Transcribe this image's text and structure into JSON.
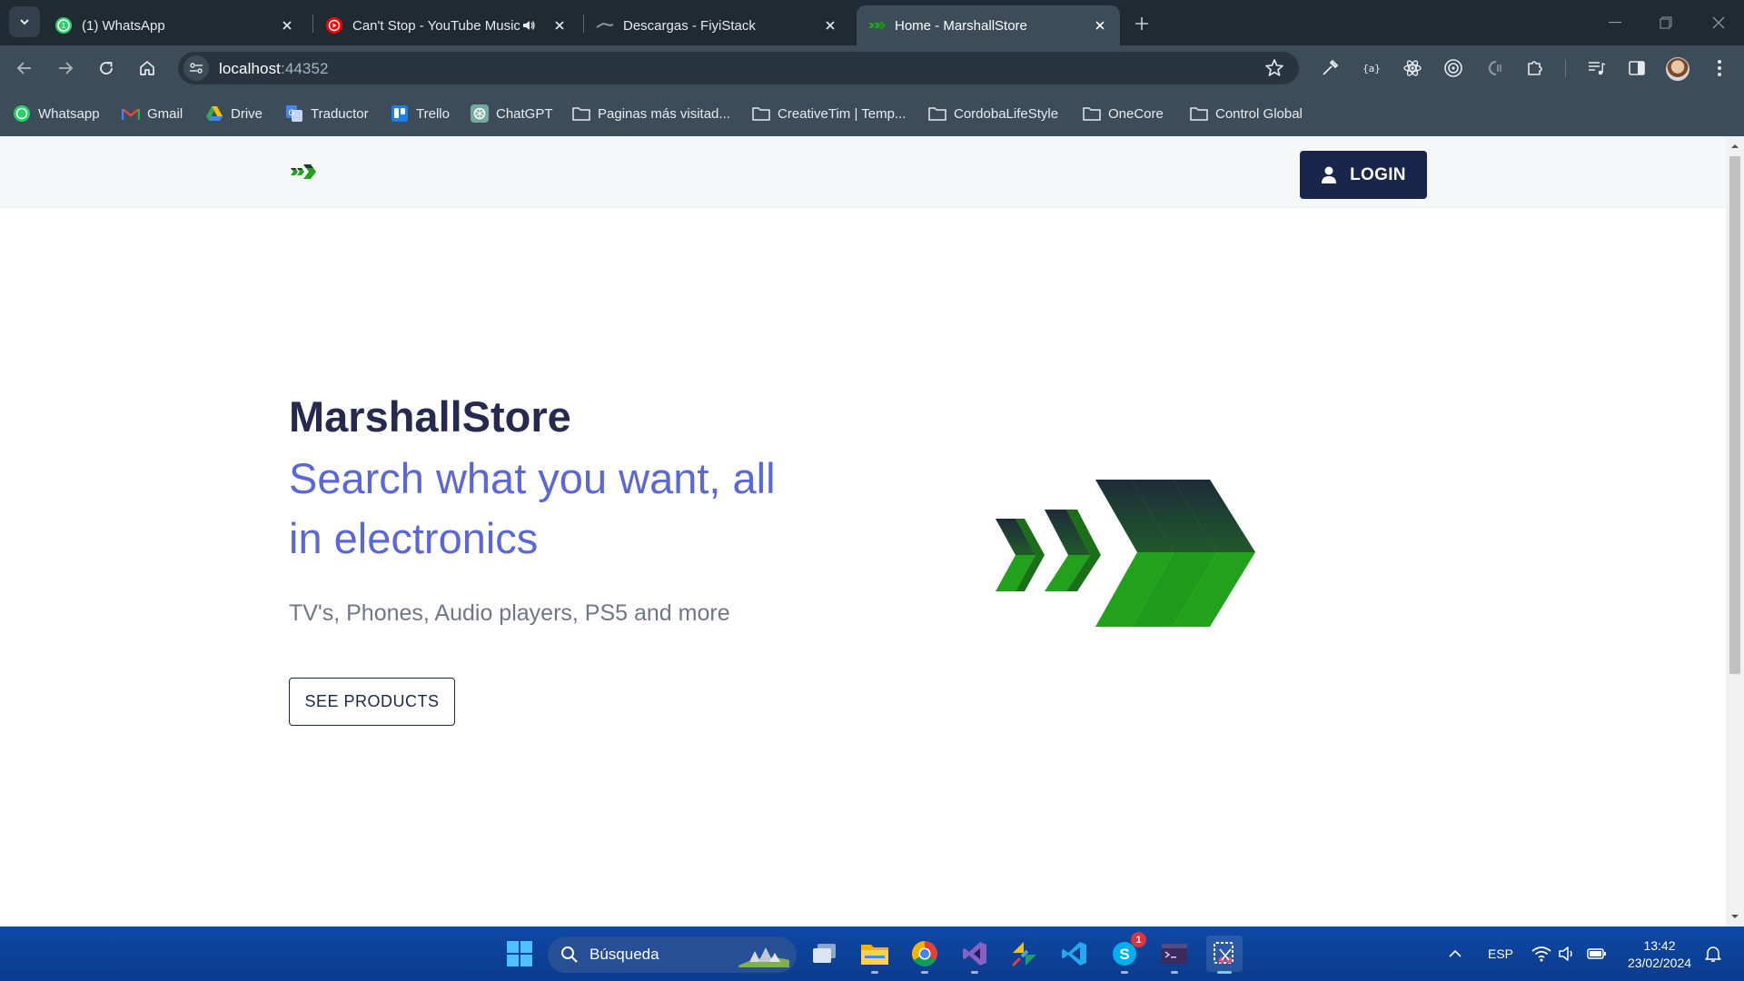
{
  "browser": {
    "tabs": [
      {
        "title": "(1) WhatsApp",
        "icon": "whatsapp-icon",
        "active": false
      },
      {
        "title": "Can't Stop - YouTube Music",
        "icon": "youtube-music-icon",
        "audio": true,
        "active": false
      },
      {
        "title": "Descargas - FiyiStack",
        "icon": "fiyistack-icon",
        "active": false
      },
      {
        "title": "Home - MarshallStore",
        "icon": "marshallstore-icon",
        "active": true
      }
    ],
    "url_host": "localhost",
    "url_port": ":44352",
    "bookmarks": [
      {
        "label": "Whatsapp",
        "icon": "whatsapp-icon"
      },
      {
        "label": "Gmail",
        "icon": "gmail-icon"
      },
      {
        "label": "Drive",
        "icon": "drive-icon"
      },
      {
        "label": "Traductor",
        "icon": "translate-icon"
      },
      {
        "label": "Trello",
        "icon": "trello-icon"
      },
      {
        "label": "ChatGPT",
        "icon": "chatgpt-icon"
      },
      {
        "label": "Paginas más visitad...",
        "icon": "folder-icon"
      },
      {
        "label": "CreativeTim | Temp...",
        "icon": "folder-icon"
      },
      {
        "label": "CordobaLifeStyle",
        "icon": "folder-icon"
      },
      {
        "label": "OneCore",
        "icon": "folder-icon"
      },
      {
        "label": "Control Global",
        "icon": "folder-icon"
      }
    ]
  },
  "page": {
    "nav": {
      "login_label": "LOGIN"
    },
    "hero": {
      "title": "MarshallStore",
      "subtitle": "Search what you want, all in electronics",
      "description": "TV's, Phones, Audio players, PS5 and more",
      "cta_label": "SEE PRODUCTS"
    },
    "colors": {
      "brand_green": "#22a11d",
      "brand_dark": "#17264a",
      "accent_blue": "#5a67d8"
    }
  },
  "taskbar": {
    "search_placeholder": "Búsqueda",
    "apps": [
      "start-icon",
      "task-view-icon",
      "file-explorer-icon",
      "chrome-icon",
      "visual-studio-icon",
      "git-diff-icon",
      "vscode-icon",
      "skype-icon",
      "terminal-icon",
      "snipping-tool-icon"
    ],
    "skype_badge": "1",
    "language": "ESP",
    "time": "13:42",
    "date": "23/02/2024"
  }
}
